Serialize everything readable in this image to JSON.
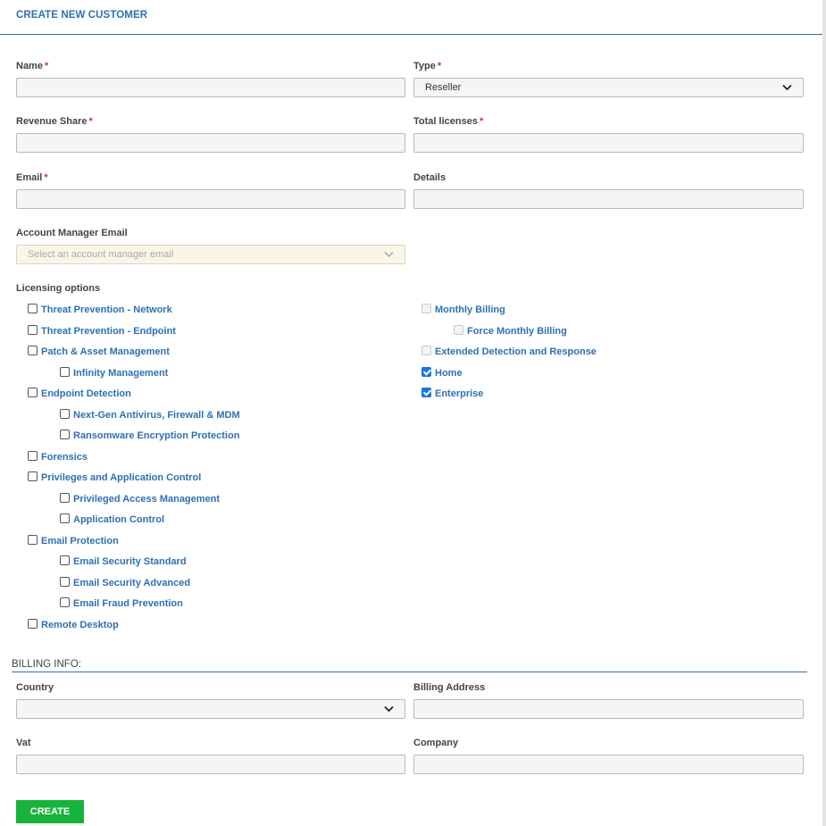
{
  "header": {
    "title": "CREATE NEW CUSTOMER"
  },
  "form": {
    "name": {
      "label": "Name",
      "required_mark": "*",
      "value": ""
    },
    "type": {
      "label": "Type",
      "required_mark": "*",
      "value": "Reseller"
    },
    "revenue_share": {
      "label": "Revenue Share",
      "required_mark": "*",
      "value": ""
    },
    "total_licenses": {
      "label": "Total licenses",
      "required_mark": "*",
      "value": ""
    },
    "email": {
      "label": "Email",
      "required_mark": "*",
      "value": ""
    },
    "details": {
      "label": "Details",
      "value": ""
    },
    "account_manager_email": {
      "label": "Account Manager Email",
      "placeholder": "Select an account manager email"
    }
  },
  "licensing": {
    "label": "Licensing options",
    "left": [
      {
        "label": "Threat Prevention - Network",
        "checked": false
      },
      {
        "label": "Threat Prevention - Endpoint",
        "checked": false
      },
      {
        "label": "Patch & Asset Management",
        "checked": false
      },
      {
        "label": "Infinity Management",
        "checked": false
      },
      {
        "label": "Endpoint Detection",
        "checked": false
      },
      {
        "label": "Next-Gen Antivirus, Firewall & MDM",
        "checked": false
      },
      {
        "label": "Ransomware Encryption Protection",
        "checked": false
      },
      {
        "label": "Forensics",
        "checked": false
      },
      {
        "label": "Privileges and Application Control",
        "checked": false
      },
      {
        "label": "Privileged Access Management",
        "checked": false
      },
      {
        "label": "Application Control",
        "checked": false
      },
      {
        "label": "Email Protection",
        "checked": false
      },
      {
        "label": "Email Security Standard",
        "checked": false
      },
      {
        "label": "Email Security Advanced",
        "checked": false
      },
      {
        "label": "Email Fraud Prevention",
        "checked": false
      },
      {
        "label": "Remote Desktop",
        "checked": false
      }
    ],
    "right": [
      {
        "label": "Monthly Billing",
        "checked": false,
        "disabled": true
      },
      {
        "label": "Force Monthly Billing",
        "checked": false,
        "disabled": true
      },
      {
        "label": "Extended Detection and Response",
        "checked": false,
        "disabled": true
      },
      {
        "label": "Home",
        "checked": true,
        "disabled": false
      },
      {
        "label": "Enterprise",
        "checked": true,
        "disabled": false
      }
    ]
  },
  "billing": {
    "title": "BILLING INFO:",
    "country": {
      "label": "Country",
      "value": ""
    },
    "billing_address": {
      "label": "Billing Address",
      "value": ""
    },
    "vat": {
      "label": "Vat",
      "value": ""
    },
    "company": {
      "label": "Company",
      "value": ""
    }
  },
  "actions": {
    "create_label": "CREATE"
  }
}
